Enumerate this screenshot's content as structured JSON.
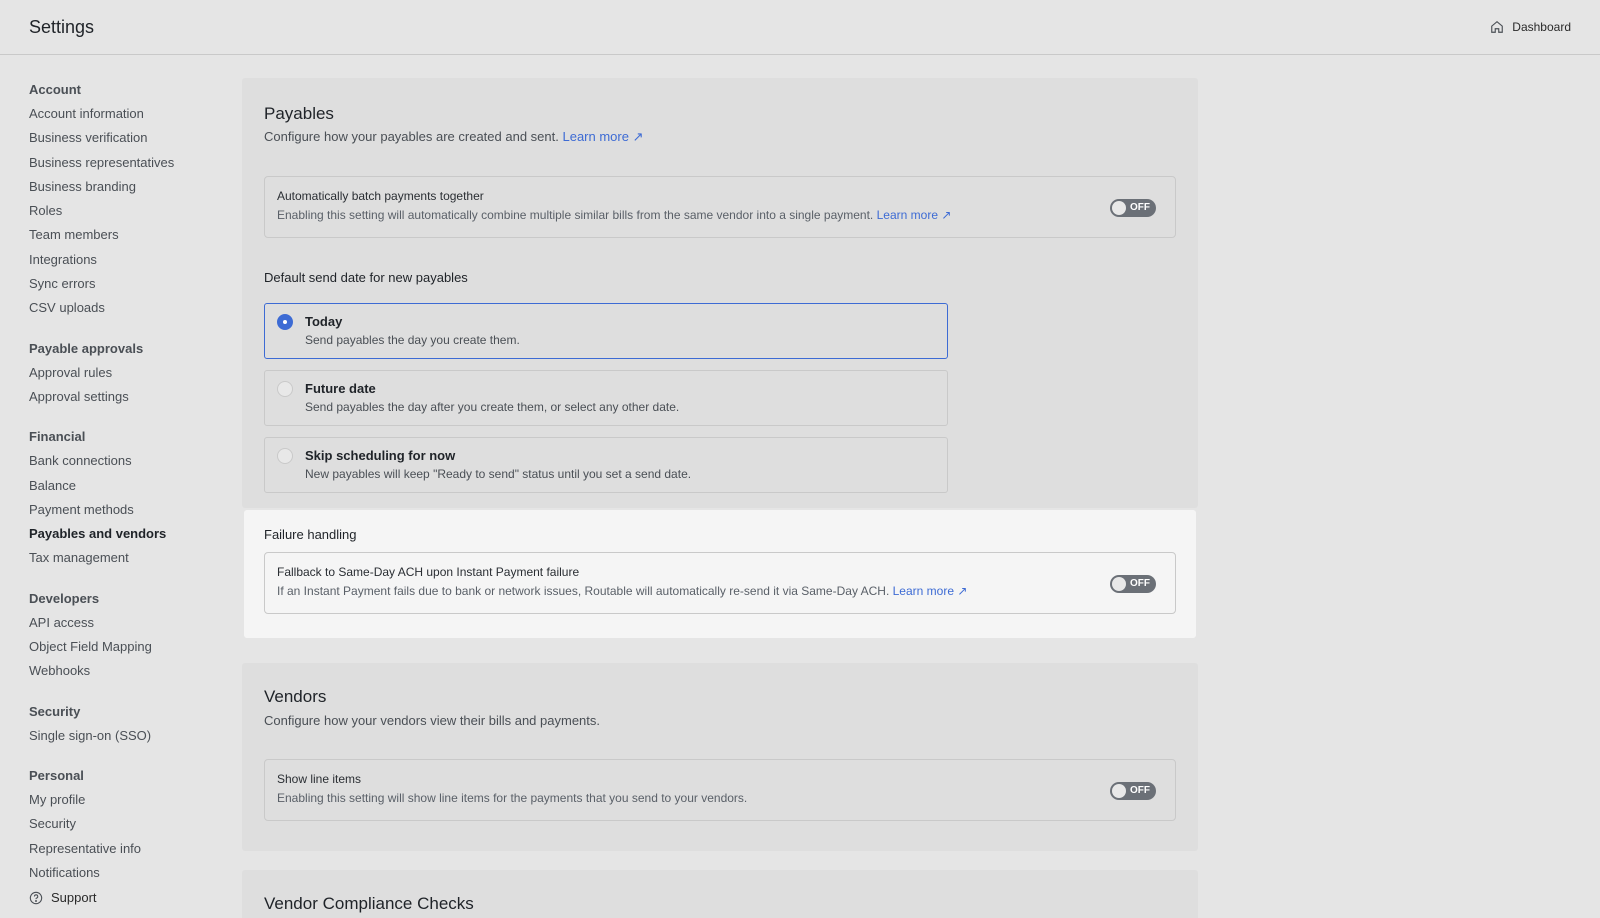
{
  "header": {
    "title": "Settings",
    "dashboard_label": "Dashboard"
  },
  "sidebar": {
    "groups": [
      {
        "heading": "Account",
        "items": [
          "Account information",
          "Business verification",
          "Business representatives",
          "Business branding",
          "Roles",
          "Team members",
          "Integrations",
          "Sync errors",
          "CSV uploads"
        ]
      },
      {
        "heading": "Payable approvals",
        "items": [
          "Approval rules",
          "Approval settings"
        ]
      },
      {
        "heading": "Financial",
        "items": [
          "Bank connections",
          "Balance",
          "Payment methods",
          "Payables and vendors",
          "Tax management"
        ]
      },
      {
        "heading": "Developers",
        "items": [
          "API access",
          "Object Field Mapping",
          "Webhooks"
        ]
      },
      {
        "heading": "Security",
        "items": [
          "Single sign-on (SSO)"
        ]
      },
      {
        "heading": "Personal",
        "items": [
          "My profile",
          "Security",
          "Representative info",
          "Notifications"
        ]
      }
    ],
    "active_item": "Payables and vendors",
    "support_label": "Support"
  },
  "payables": {
    "title": "Payables",
    "description": "Configure how your payables are created and sent.",
    "learn_more": "Learn more ↗",
    "batch": {
      "title": "Automatically batch payments together",
      "description": "Enabling this setting will automatically combine multiple similar bills from the same vendor into a single payment.",
      "learn_more": "Learn more ↗",
      "toggle": "OFF"
    },
    "send_date_heading": "Default send date for new payables",
    "send_date_options": [
      {
        "title": "Today",
        "description": "Send payables the day you create them.",
        "selected": true
      },
      {
        "title": "Future date",
        "description": "Send payables the day after you create them, or select any other date.",
        "selected": false
      },
      {
        "title": "Skip scheduling for now",
        "description": "New payables will keep \"Ready to send\" status until you set a send date.",
        "selected": false
      }
    ]
  },
  "failure": {
    "heading": "Failure handling",
    "fallback": {
      "title": "Fallback to Same-Day ACH upon Instant Payment failure",
      "description": "If an Instant Payment fails due to bank or network issues, Routable will automatically re-send it via Same-Day ACH.",
      "learn_more": "Learn more ↗",
      "toggle": "OFF"
    }
  },
  "vendors": {
    "title": "Vendors",
    "description": "Configure how your vendors view their bills and payments.",
    "line_items": {
      "title": "Show line items",
      "description": "Enabling this setting will show line items for the payments that you send to your vendors.",
      "toggle": "OFF"
    }
  },
  "compliance": {
    "title": "Vendor Compliance Checks"
  },
  "colors": {
    "accent": "#3d6bd4",
    "toggle_off": "#6b7077"
  }
}
